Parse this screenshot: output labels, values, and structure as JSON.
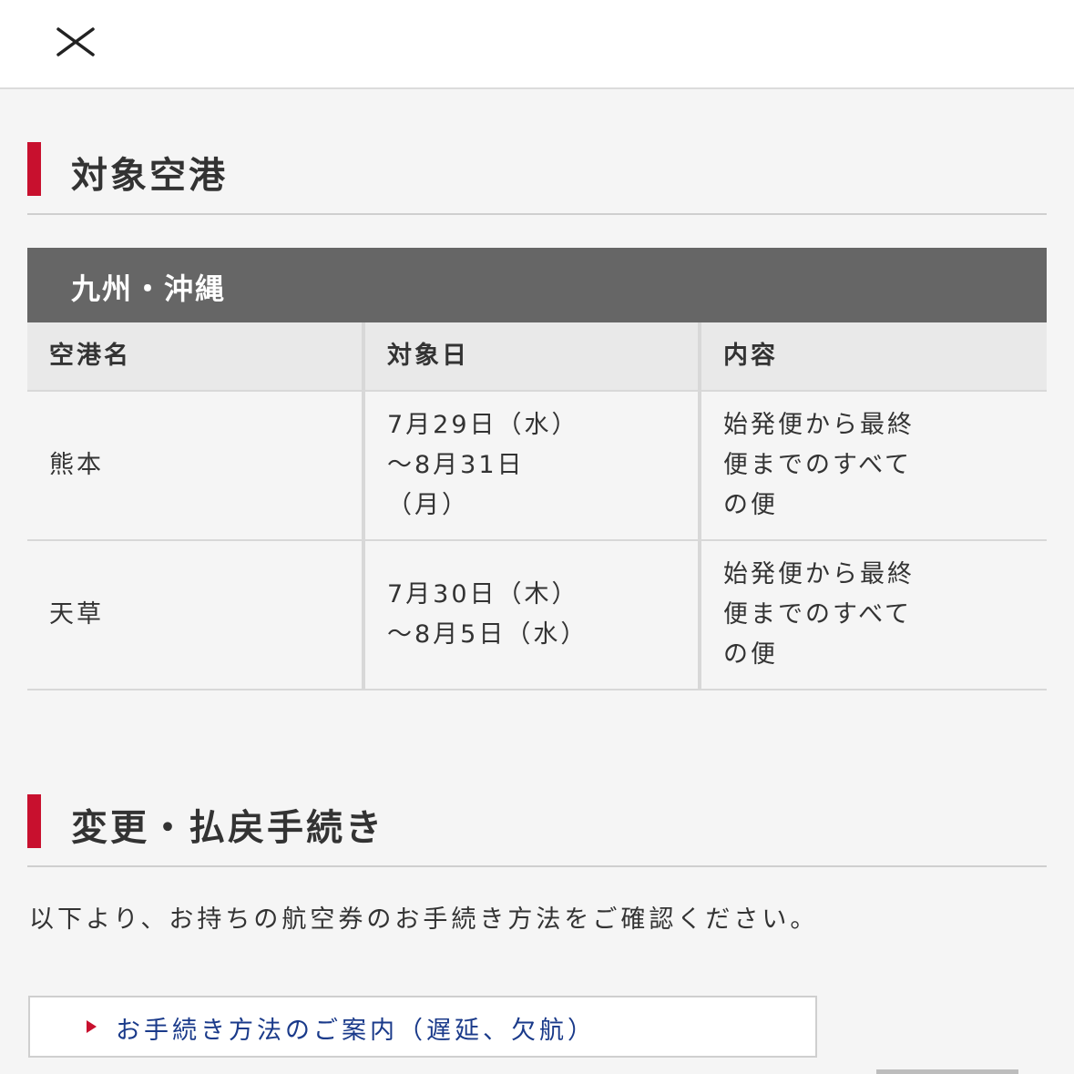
{
  "header": {
    "close_icon": "close-icon"
  },
  "section_airports": {
    "title": "対象空港",
    "region": "九州・沖縄",
    "columns": [
      "空港名",
      "対象日",
      "内容"
    ],
    "rows": [
      {
        "airport": "熊本",
        "dates": [
          "7月29日（水）",
          "〜8月31日",
          "（月）"
        ],
        "content": [
          "始発便から最終",
          "便までのすべて",
          "の便"
        ]
      },
      {
        "airport": "天草",
        "dates": [
          "7月30日（木）",
          "〜8月5日（水）"
        ],
        "content": [
          "始発便から最終",
          "便までのすべて",
          "の便"
        ]
      }
    ]
  },
  "section_procedures": {
    "title": "変更・払戻手続き",
    "intro": "以下より、お持ちの航空券のお手続き方法をご確認ください。",
    "link_label": "お手続き方法のご案内（遅延、欠航）"
  },
  "colors": {
    "accent": "#c8102e",
    "region_bar": "#666666",
    "link": "#1a3a8a"
  }
}
